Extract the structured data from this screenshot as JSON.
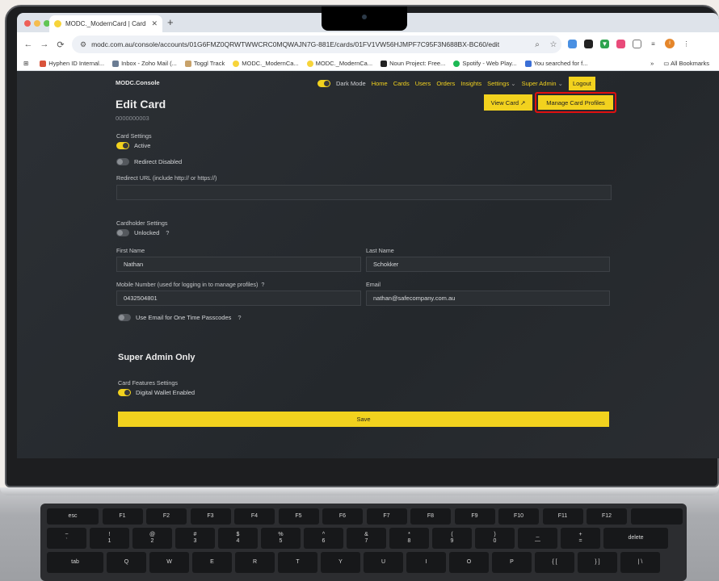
{
  "browser": {
    "tab_title": "MODC._ModernCard | Card I",
    "new_tab": "+",
    "url": "modc.com.au/console/accounts/01G6FMZ0QRWTWWCRC0MQWAJN7G-881E/cards/01FV1VW56HJMPF7C95F3N688BX-BC60/edit",
    "nav": {
      "back": "←",
      "forward": "→",
      "reload": "C"
    },
    "bookmarks": [
      {
        "label": "Hyphen ID Internal...",
        "color": "#d9533a"
      },
      {
        "label": "Inbox - Zoho Mail (...",
        "color": "#6b7c93"
      },
      {
        "label": "Toggl Track",
        "color": "#c8a26a"
      },
      {
        "label": "MODC._ModernCa...",
        "color": "#f7d43a"
      },
      {
        "label": "MODC._ModernCa...",
        "color": "#f7d43a"
      },
      {
        "label": "Noun Project: Free...",
        "color": "#222222"
      },
      {
        "label": "Spotify - Web Play...",
        "color": "#1db954"
      },
      {
        "label": "You searched for f...",
        "color": "#3b6fd6"
      }
    ],
    "more_bookmarks": "»",
    "all_bookmarks": "All Bookmarks",
    "profile_initial": "i"
  },
  "app": {
    "brand": "MODC.Console",
    "dark_mode_label": "Dark Mode",
    "nav": {
      "home": "Home",
      "cards": "Cards",
      "users": "Users",
      "orders": "Orders",
      "insights": "Insights",
      "settings": "Settings",
      "super_admin": "Super Admin"
    },
    "logout": "Logout",
    "title": "Edit Card",
    "card_id": "0000000003",
    "view_card": "View Card ↗",
    "manage_profiles": "Manage Card Profiles",
    "card_settings": {
      "label": "Card Settings",
      "active": "Active",
      "redirect": "Redirect Disabled",
      "redirect_url_label": "Redirect URL (include http:// or https://)",
      "redirect_url_value": ""
    },
    "cardholder": {
      "label": "Cardholder Settings",
      "unlocked": "Unlocked",
      "help": "?",
      "first_name_label": "First Name",
      "first_name": "Nathan",
      "last_name_label": "Last Name",
      "last_name": "Schokker",
      "mobile_label": "Mobile Number (used for logging in to manage profiles)",
      "mobile": "0432504801",
      "email_label": "Email",
      "email": "nathan@safecompany.com.au",
      "use_email_otp": "Use Email for One Time Passcodes"
    },
    "super_admin": {
      "title": "Super Admin Only",
      "features_label": "Card Features Settings",
      "wallet": "Digital Wallet Enabled"
    },
    "save": "Save"
  },
  "keyboard": {
    "fn_row": [
      "esc",
      "F1",
      "F2",
      "F3",
      "F4",
      "F5",
      "F6",
      "F7",
      "F8",
      "F9",
      "F10",
      "F11",
      "F12",
      ""
    ],
    "num_row": [
      [
        "~",
        "`"
      ],
      [
        "!",
        "1"
      ],
      [
        "@",
        "2"
      ],
      [
        "#",
        "3"
      ],
      [
        "$",
        "4"
      ],
      [
        "%",
        "5"
      ],
      [
        "^",
        "6"
      ],
      [
        "&",
        "7"
      ],
      [
        "*",
        "8"
      ],
      [
        "(",
        "9"
      ],
      [
        ")",
        "0"
      ],
      [
        "_",
        "—"
      ],
      [
        "+",
        "="
      ],
      [
        "",
        "delete"
      ]
    ],
    "top_row": [
      "tab",
      "Q",
      "W",
      "E",
      "R",
      "T",
      "Y",
      "U",
      "I",
      "O",
      "P",
      "{ [",
      "} ]",
      "| \\"
    ]
  }
}
